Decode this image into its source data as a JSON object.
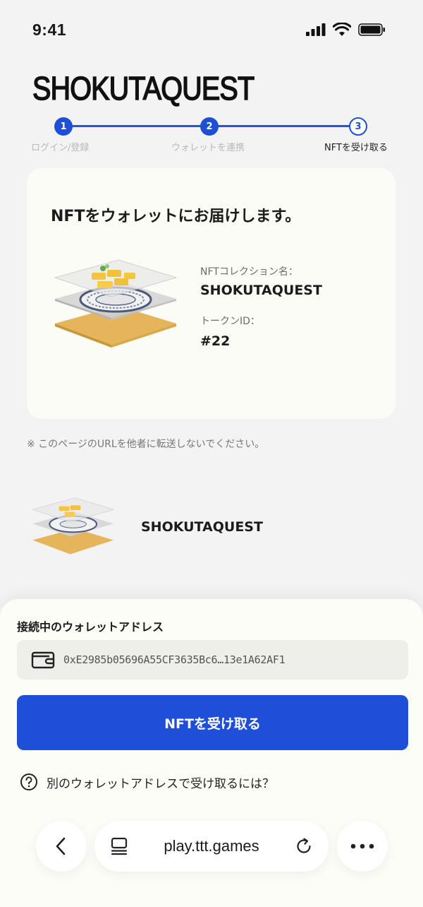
{
  "status_bar": {
    "time": "9:41"
  },
  "app": {
    "logo": "SHOKUTAQUEST"
  },
  "stepper": {
    "steps": [
      {
        "number": "1",
        "label": "ログイン/登録"
      },
      {
        "number": "2",
        "label": "ウォレットを連携"
      },
      {
        "number": "3",
        "label": "NFTを受け取る"
      }
    ],
    "current_step": 3
  },
  "nft_card": {
    "title": "NFTをウォレットにお届けします。",
    "collection_label": "NFTコレクション名：",
    "collection_name": "SHOKUTAQUEST",
    "token_label": "トークンID：",
    "token_id": "#22"
  },
  "note": "※ このページのURLを他者に転送しないでください。",
  "background_item": {
    "name": "SHOKUTAQUEST"
  },
  "wallet_sheet": {
    "title": "接続中のウォレットアドレス",
    "address": "0xE2985b05696A55CF3635Bc6…13e1A62AF1",
    "receive_button": "NFTを受け取る",
    "help_link": "別のウォレットアドレスで受け取るには？"
  },
  "browser": {
    "url": "play.ttt.games",
    "icons": [
      "back-icon",
      "tabs-icon",
      "reload-icon",
      "more-icon"
    ]
  },
  "colors": {
    "accent": "#1f4fd6",
    "background": "#f3f3f3",
    "card": "#fcfcf7"
  }
}
